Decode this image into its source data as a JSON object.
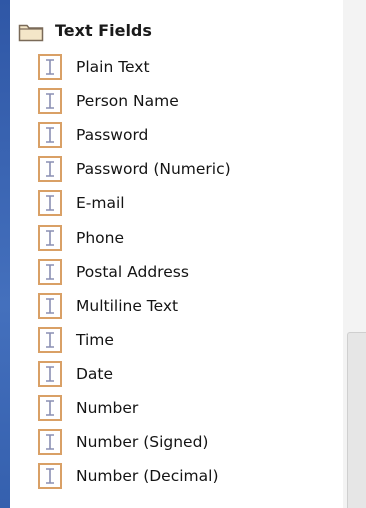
{
  "palette": {
    "category": {
      "title": "Text Fields",
      "icon": "folder-icon"
    },
    "items": [
      {
        "label": "Plain Text",
        "icon": "text-field-icon"
      },
      {
        "label": "Person Name",
        "icon": "text-field-icon"
      },
      {
        "label": "Password",
        "icon": "text-field-icon"
      },
      {
        "label": "Password (Numeric)",
        "icon": "text-field-icon"
      },
      {
        "label": "E-mail",
        "icon": "text-field-icon"
      },
      {
        "label": "Phone",
        "icon": "text-field-icon"
      },
      {
        "label": "Postal Address",
        "icon": "text-field-icon"
      },
      {
        "label": "Multiline Text",
        "icon": "text-field-icon"
      },
      {
        "label": "Time",
        "icon": "text-field-icon"
      },
      {
        "label": "Date",
        "icon": "text-field-icon"
      },
      {
        "label": "Number",
        "icon": "text-field-icon"
      },
      {
        "label": "Number (Signed)",
        "icon": "text-field-icon"
      },
      {
        "label": "Number (Decimal)",
        "icon": "text-field-icon"
      }
    ]
  },
  "colors": {
    "icon_border": "#d9a066",
    "icon_cursor": "#8a8fb3",
    "folder_fill": "#f4e6c8",
    "folder_stroke": "#7a6a58",
    "background": "#3c66b3"
  }
}
